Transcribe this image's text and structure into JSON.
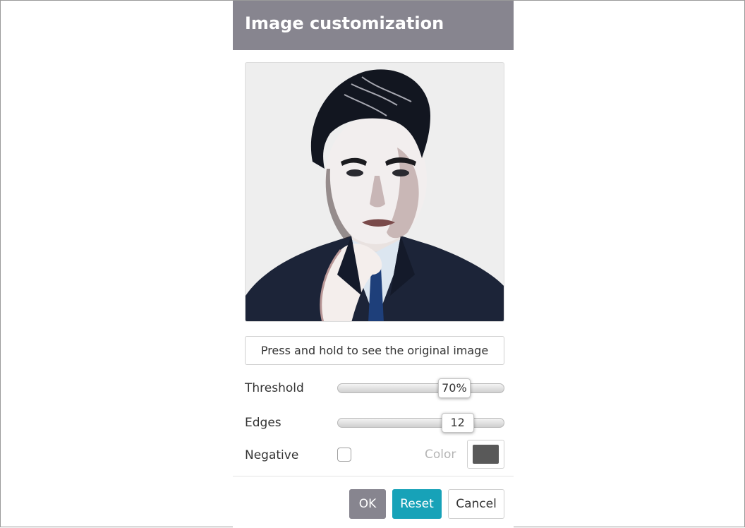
{
  "dialog": {
    "title": "Image customization"
  },
  "preview": {
    "press_button_label": "Press and hold to see the original image"
  },
  "controls": {
    "threshold": {
      "label": "Threshold",
      "value_text": "70%",
      "fraction": 0.7
    },
    "edges": {
      "label": "Edges",
      "value_text": "12",
      "fraction": 0.72
    },
    "negative": {
      "label": "Negative",
      "checked": false
    },
    "color": {
      "label": "Color",
      "value": "#595959"
    }
  },
  "footer": {
    "ok_label": "OK",
    "reset_label": "Reset",
    "cancel_label": "Cancel"
  },
  "colors": {
    "header": "#87858f",
    "accent": "#17a2b8"
  }
}
